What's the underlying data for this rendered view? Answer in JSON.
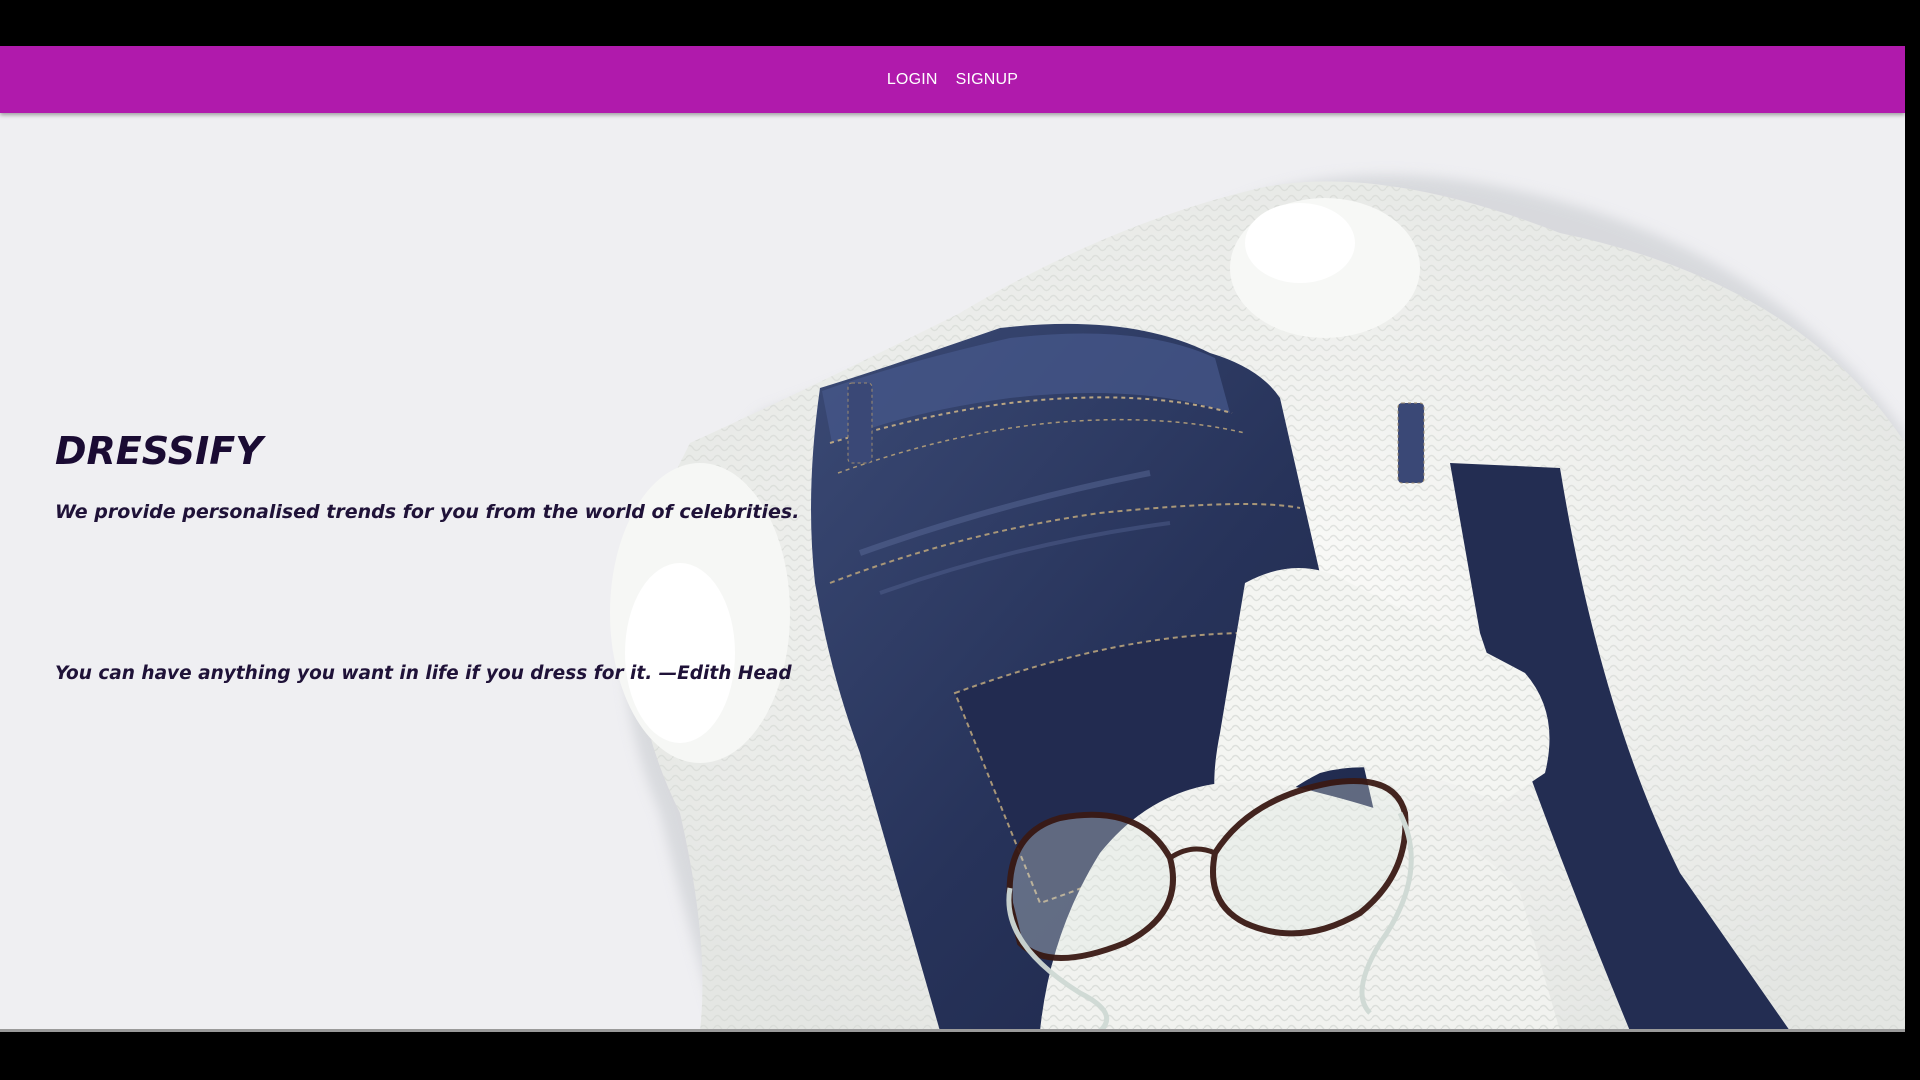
{
  "navbar": {
    "links": [
      "LOGIN",
      "SIGNUP"
    ],
    "background": "#b01aac"
  },
  "hero": {
    "title": "DRESSIFY",
    "tagline": "We provide personalised trends for you from the world of celebrities.",
    "quote": "You can have anything you want in life if you dress for it. —Edith Head",
    "image": "denim-jeans-white-sweater-eyeglasses-photo",
    "text_color": "#1a0b33"
  }
}
